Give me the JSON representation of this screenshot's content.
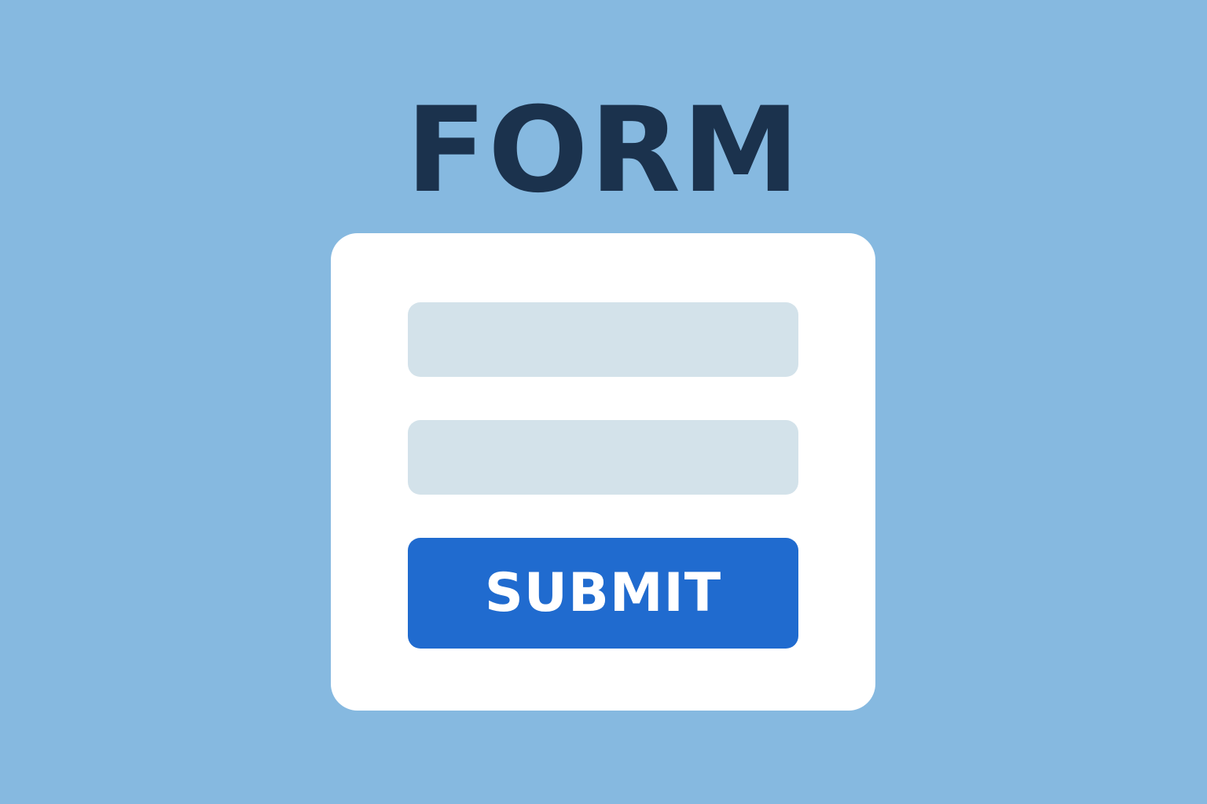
{
  "page": {
    "title": "FORM",
    "background_color": "#86b9e0"
  },
  "form": {
    "card_color": "#ffffff",
    "fields": [
      {
        "value": "",
        "placeholder": "",
        "color": "#d3e2ea"
      },
      {
        "value": "",
        "placeholder": "",
        "color": "#d3e2ea"
      }
    ],
    "submit_label": "SUBMIT",
    "submit_color": "#206bcf"
  },
  "colors": {
    "title": "#1b324d",
    "submit_text": "#ffffff"
  }
}
